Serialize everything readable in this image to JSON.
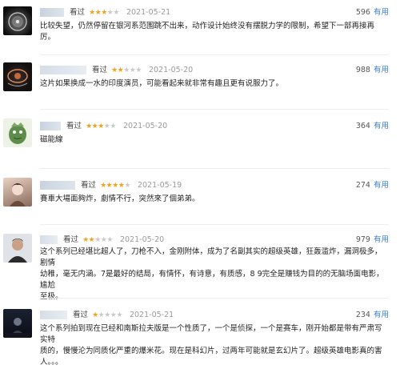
{
  "reviews": [
    {
      "watched": "看过",
      "stars": 3,
      "date": "2021-05-21",
      "votes": "596",
      "useful": "有用",
      "text": "比较失望，仍然停留在银河系范围跳不出来，动作设计始终没有摆脱力学的限制，希望下一部再接再厉。"
    },
    {
      "watched": "看过",
      "stars": 2,
      "date": "2021-05-20",
      "votes": "988",
      "useful": "有用",
      "text": "这片如果换成一水的印度演员，可能看起来就非常有趣且更有说服力了。"
    },
    {
      "watched": "看过",
      "stars": 3,
      "date": "2021-05-20",
      "votes": "364",
      "useful": "有用",
      "text": "磁能線"
    },
    {
      "watched": "看过",
      "stars": 4,
      "date": "2021-05-19",
      "votes": "274",
      "useful": "有用",
      "text": "賽車大場面夠炸，劇情不行，突然來了個弟弟。"
    },
    {
      "watched": "看过",
      "stars": 2,
      "date": "2021-05-20",
      "votes": "979",
      "useful": "有用",
      "text": "这个系列已经堪比超人了，刀枪不入，金刚附体，成为了名副其实的超级英雄，狂轰滥炸，漏洞极多，剧情\n幼稚，毫无内涵。7是最好的结局，有情怀，有诗意，有质感，8 9完全是赚钱为目的的无脑场面电影，尴尬\n至极。"
    },
    {
      "watched": "看过",
      "stars": 1,
      "date": "2021-05-21",
      "votes": "234",
      "useful": "有用",
      "text": "这个系列拍到现在已经和南斯拉夫版是一个性质了，一个是侦探，一个是赛车，刚开始都是带有严肃写实特\n质的，慢慢沦为同质化严重的爆米花。现在是科幻片，过两年可能就是玄幻片了。超级英雄电影真的害\n人。。。"
    }
  ]
}
